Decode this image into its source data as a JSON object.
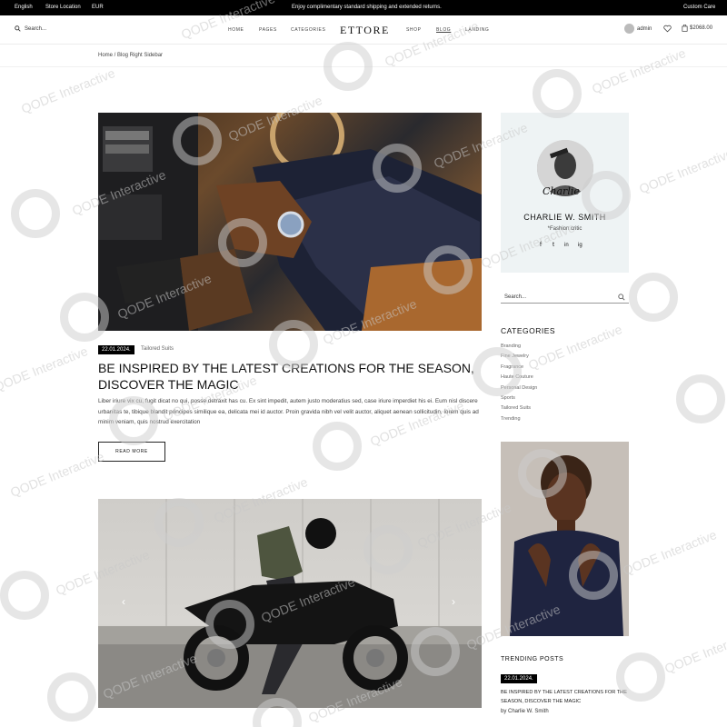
{
  "topbar": {
    "language": "English",
    "store_location": "Store Location",
    "currency": "EUR",
    "promo": "Enjoy complimentary standard shipping and extended returns.",
    "custom_care": "Custom Care"
  },
  "header": {
    "search_label": "Search...",
    "nav": [
      "HOME",
      "PAGES",
      "CATEGORIES",
      "SHOP",
      "BLOG",
      "LANDING"
    ],
    "logo": "ETTORE",
    "user": "admin",
    "cart_total": "$2068.00"
  },
  "breadcrumb": "Home / Blog Right Sidebar",
  "post1": {
    "date": "22.01.2024.",
    "category": "Tailored Suits",
    "title": "BE INSPIRED BY THE LATEST CREATIONS FOR THE SEASON, DISCOVER THE MAGIC",
    "excerpt": "Liber iriure vix cu, fugit dicat no qui, posse detraxit has cu. Ex sint impedit, autem justo moderatius sed, case iriure imperdiet his ei. Eum nisl discere urbanitas te, tibique blandit principes similique ea, delicata mei id auctor. Proin gravida nibh vel velit auctor, aliquet aenean sollicitudin, lorem quis ad minim veniam, quis nostrud exercitation",
    "read_more": "READ MORE"
  },
  "post2": {
    "prev": "‹",
    "next": "›"
  },
  "sidebar": {
    "author_signature": "Charlie",
    "author_name": "CHARLIE W. SMITH",
    "author_role": "*Fashion critic",
    "social": [
      "f",
      "t",
      "in",
      "ig"
    ],
    "search_placeholder": "Search...",
    "categories_heading": "CATEGORIES",
    "categories": [
      "Branding",
      "Fine Jewelry",
      "Fragrance",
      "Haute Couture",
      "Personal Design",
      "Sports",
      "Tailored Suits",
      "Trending"
    ],
    "trending_heading": "TRENDING POSTS",
    "trending_date": "22.01.2024.",
    "trending_title": "BE INSPIRED BY THE LATEST CREATIONS FOR THE SEASON, DISCOVER THE MAGIC",
    "trending_by": "by Charlie W. Smith"
  },
  "watermark_text": "QODE Interactive",
  "colors": {
    "topbar_bg": "#000000",
    "author_card_bg": "#eef3f4",
    "accent": "#111111"
  }
}
